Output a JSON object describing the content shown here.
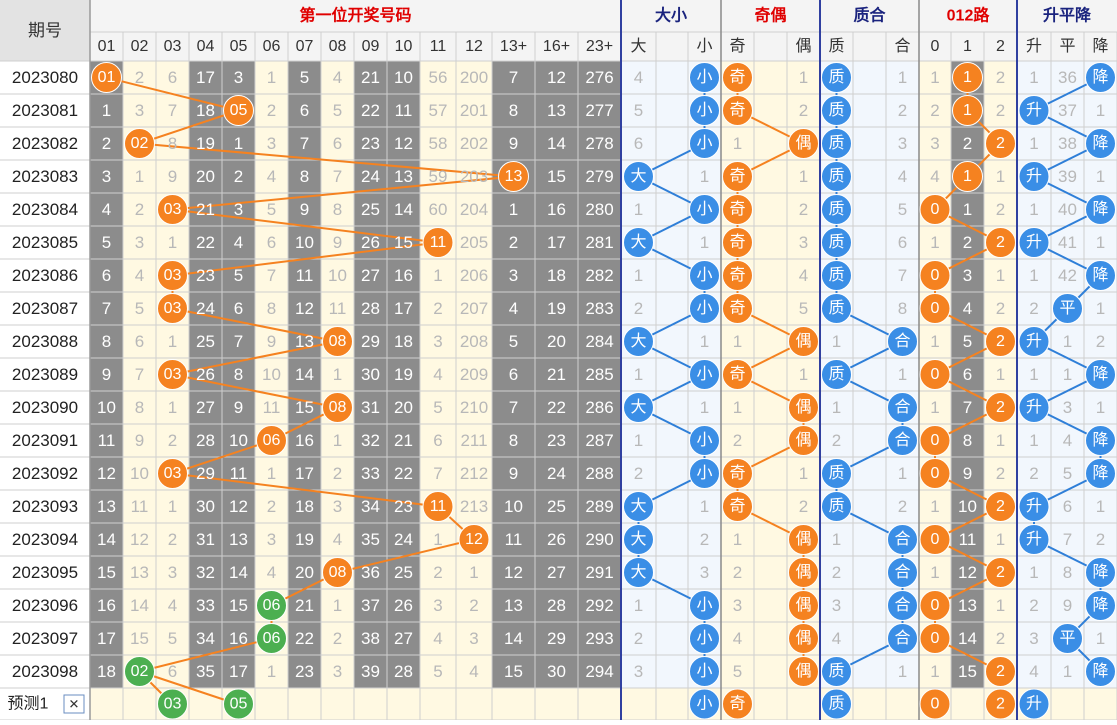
{
  "header": {
    "period_label": "期号",
    "groups": [
      {
        "label": "第一位开奖号码",
        "color": "#e00000"
      },
      {
        "label": "大小",
        "color": "#1a237e"
      },
      {
        "label": "奇偶",
        "color": "#e00000"
      },
      {
        "label": "质合",
        "color": "#1a237e"
      },
      {
        "label": "012路",
        "color": "#e00000"
      },
      {
        "label": "升平降",
        "color": "#1a237e"
      }
    ],
    "columns": [
      "01",
      "02",
      "03",
      "04",
      "05",
      "06",
      "07",
      "08",
      "09",
      "10",
      "11",
      "12",
      "13+",
      "16+",
      "23+",
      "大",
      "",
      "小",
      "奇",
      "",
      "偶",
      "质",
      "",
      "合",
      "0",
      "1",
      "2",
      "升",
      "平",
      "降"
    ]
  },
  "colors": {
    "orange": "#f58220",
    "green": "#4caf50",
    "blue": "#3a8ee6",
    "gray": "#8c8c8c",
    "miss_text": "#b8b8b8",
    "hit_line_orange": "#f58220",
    "hit_line_blue": "#2f7fd8"
  },
  "chart_data": {
    "type": "table",
    "periods": [
      "2023080",
      "2023081",
      "2023082",
      "2023083",
      "2023084",
      "2023085",
      "2023086",
      "2023087",
      "2023088",
      "2023089",
      "2023090",
      "2023091",
      "2023092",
      "2023093",
      "2023094",
      "2023095",
      "2023096",
      "2023097",
      "2023098"
    ],
    "rows": [
      [
        "01",
        "2",
        "6",
        "17",
        "3",
        "1",
        "5",
        "4",
        "21",
        "10",
        "56",
        "200",
        "7",
        "12",
        "276",
        "4",
        "",
        "小",
        "奇",
        "",
        "1",
        "质",
        "",
        "1",
        "1",
        "1",
        "2",
        "1",
        "36",
        "降"
      ],
      [
        "1",
        "3",
        "7",
        "18",
        "05",
        "2",
        "6",
        "5",
        "22",
        "11",
        "57",
        "201",
        "8",
        "13",
        "277",
        "5",
        "",
        "小",
        "奇",
        "",
        "2",
        "质",
        "",
        "2",
        "2",
        "1",
        "2",
        "升",
        "37",
        "1"
      ],
      [
        "2",
        "02",
        "8",
        "19",
        "1",
        "3",
        "7",
        "6",
        "23",
        "12",
        "58",
        "202",
        "9",
        "14",
        "278",
        "6",
        "",
        "小",
        "1",
        "",
        "偶",
        "质",
        "",
        "3",
        "3",
        "2",
        "2",
        "1",
        "38",
        "降"
      ],
      [
        "3",
        "1",
        "9",
        "20",
        "2",
        "4",
        "8",
        "7",
        "24",
        "13",
        "59",
        "203",
        "13",
        "15",
        "279",
        "大",
        "",
        "1",
        "奇",
        "",
        "1",
        "质",
        "",
        "4",
        "4",
        "1",
        "1",
        "升",
        "39",
        "1"
      ],
      [
        "4",
        "2",
        "03",
        "21",
        "3",
        "5",
        "9",
        "8",
        "25",
        "14",
        "60",
        "204",
        "1",
        "16",
        "280",
        "1",
        "",
        "小",
        "奇",
        "",
        "2",
        "质",
        "",
        "5",
        "0",
        "1",
        "2",
        "1",
        "40",
        "降"
      ],
      [
        "5",
        "3",
        "1",
        "22",
        "4",
        "6",
        "10",
        "9",
        "26",
        "15",
        "11",
        "205",
        "2",
        "17",
        "281",
        "大",
        "",
        "1",
        "奇",
        "",
        "3",
        "质",
        "",
        "6",
        "1",
        "2",
        "2",
        "升",
        "41",
        "1"
      ],
      [
        "6",
        "4",
        "03",
        "23",
        "5",
        "7",
        "11",
        "10",
        "27",
        "16",
        "1",
        "206",
        "3",
        "18",
        "282",
        "1",
        "",
        "小",
        "奇",
        "",
        "4",
        "质",
        "",
        "7",
        "0",
        "3",
        "1",
        "1",
        "42",
        "降"
      ],
      [
        "7",
        "5",
        "03",
        "24",
        "6",
        "8",
        "12",
        "11",
        "28",
        "17",
        "2",
        "207",
        "4",
        "19",
        "283",
        "2",
        "",
        "小",
        "奇",
        "",
        "5",
        "质",
        "",
        "8",
        "0",
        "4",
        "2",
        "2",
        "平",
        "1"
      ],
      [
        "8",
        "6",
        "1",
        "25",
        "7",
        "9",
        "13",
        "08",
        "29",
        "18",
        "3",
        "208",
        "5",
        "20",
        "284",
        "大",
        "",
        "1",
        "1",
        "",
        "偶",
        "1",
        "",
        "合",
        "1",
        "5",
        "2",
        "升",
        "1",
        "2"
      ],
      [
        "9",
        "7",
        "03",
        "26",
        "8",
        "10",
        "14",
        "1",
        "30",
        "19",
        "4",
        "209",
        "6",
        "21",
        "285",
        "1",
        "",
        "小",
        "奇",
        "",
        "1",
        "质",
        "",
        "1",
        "0",
        "6",
        "1",
        "1",
        "1",
        "降"
      ],
      [
        "10",
        "8",
        "1",
        "27",
        "9",
        "11",
        "15",
        "08",
        "31",
        "20",
        "5",
        "210",
        "7",
        "22",
        "286",
        "大",
        "",
        "1",
        "1",
        "",
        "偶",
        "1",
        "",
        "合",
        "1",
        "7",
        "2",
        "升",
        "3",
        "1"
      ],
      [
        "11",
        "9",
        "2",
        "28",
        "10",
        "06",
        "16",
        "1",
        "32",
        "21",
        "6",
        "211",
        "8",
        "23",
        "287",
        "1",
        "",
        "小",
        "2",
        "",
        "偶",
        "2",
        "",
        "合",
        "0",
        "8",
        "1",
        "1",
        "4",
        "降"
      ],
      [
        "12",
        "10",
        "03",
        "29",
        "11",
        "1",
        "17",
        "2",
        "33",
        "22",
        "7",
        "212",
        "9",
        "24",
        "288",
        "2",
        "",
        "小",
        "奇",
        "",
        "1",
        "质",
        "",
        "1",
        "0",
        "9",
        "2",
        "2",
        "5",
        "降"
      ],
      [
        "13",
        "11",
        "1",
        "30",
        "12",
        "2",
        "18",
        "3",
        "34",
        "23",
        "11",
        "213",
        "10",
        "25",
        "289",
        "大",
        "",
        "1",
        "奇",
        "",
        "2",
        "质",
        "",
        "2",
        "1",
        "10",
        "2",
        "升",
        "6",
        "1"
      ],
      [
        "14",
        "12",
        "2",
        "31",
        "13",
        "3",
        "19",
        "4",
        "35",
        "24",
        "1",
        "12",
        "11",
        "26",
        "290",
        "大",
        "",
        "2",
        "1",
        "",
        "偶",
        "1",
        "",
        "合",
        "0",
        "11",
        "1",
        "升",
        "7",
        "2"
      ],
      [
        "15",
        "13",
        "3",
        "32",
        "14",
        "4",
        "20",
        "08",
        "36",
        "25",
        "2",
        "1",
        "12",
        "27",
        "291",
        "大",
        "",
        "3",
        "2",
        "",
        "偶",
        "2",
        "",
        "合",
        "1",
        "12",
        "2",
        "1",
        "8",
        "降"
      ],
      [
        "16",
        "14",
        "4",
        "33",
        "15",
        "06",
        "21",
        "1",
        "37",
        "26",
        "3",
        "2",
        "13",
        "28",
        "292",
        "1",
        "",
        "小",
        "3",
        "",
        "偶",
        "3",
        "",
        "合",
        "0",
        "13",
        "1",
        "2",
        "9",
        "降"
      ],
      [
        "17",
        "15",
        "5",
        "34",
        "16",
        "06",
        "22",
        "2",
        "38",
        "27",
        "4",
        "3",
        "14",
        "29",
        "293",
        "2",
        "",
        "小",
        "4",
        "",
        "偶",
        "4",
        "",
        "合",
        "0",
        "14",
        "2",
        "3",
        "平",
        "1"
      ],
      [
        "18",
        "02",
        "6",
        "35",
        "17",
        "1",
        "23",
        "3",
        "39",
        "28",
        "5",
        "4",
        "15",
        "30",
        "294",
        "3",
        "",
        "小",
        "5",
        "",
        "偶",
        "质",
        "",
        "1",
        "1",
        "15",
        "2",
        "4",
        "1",
        "降"
      ]
    ],
    "first_numbers": [
      "01",
      "05",
      "02",
      "13",
      "03",
      "11",
      "03",
      "03",
      "08",
      "03",
      "08",
      "06",
      "03",
      "11",
      "12",
      "08",
      "06",
      "06",
      "02"
    ],
    "prediction": {
      "label": "预测1",
      "close_symbol": "✕",
      "first_numbers": [
        "03",
        "05"
      ],
      "size": "小",
      "parity": "奇",
      "prime": "质",
      "route": [
        "0",
        "2"
      ],
      "trend": "升"
    }
  }
}
